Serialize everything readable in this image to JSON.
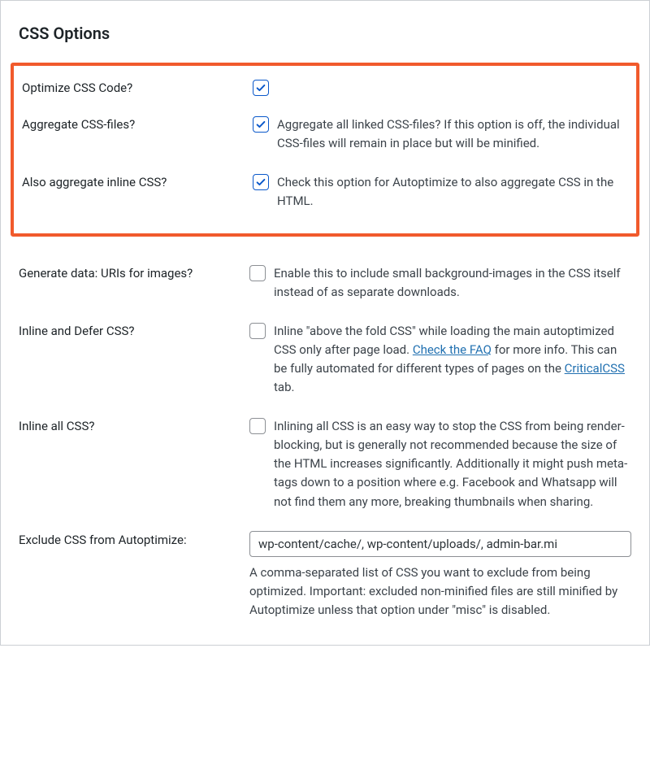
{
  "panelTitle": "CSS Options",
  "optimize": {
    "label": "Optimize CSS Code?",
    "checked": true,
    "desc": ""
  },
  "aggregate": {
    "label": "Aggregate CSS-files?",
    "checked": true,
    "desc": "Aggregate all linked CSS-files? If this option is off, the individual CSS-files will remain in place but will be minified."
  },
  "aggregateInline": {
    "label": "Also aggregate inline CSS?",
    "checked": true,
    "desc": "Check this option for Autoptimize to also aggregate CSS in the HTML."
  },
  "dataUris": {
    "label": "Generate data: URIs for images?",
    "checked": false,
    "desc": "Enable this to include small background-images in the CSS itself instead of as separate downloads."
  },
  "inlineDefer": {
    "label": "Inline and Defer CSS?",
    "checked": false,
    "desc_pre": "Inline \"above the fold CSS\" while loading the main autoptimized CSS only after page load. ",
    "faqLinkText": "Check the FAQ",
    "desc_mid": " for more info. This can be fully automated for different types of pages on the ",
    "criticalLinkText": "CriticalCSS",
    "desc_post": " tab."
  },
  "inlineAll": {
    "label": "Inline all CSS?",
    "checked": false,
    "desc": "Inlining all CSS is an easy way to stop the CSS from being render-blocking, but is generally not recommended because the size of the HTML increases significantly. Additionally it might push meta-tags down to a position where e.g. Facebook and Whatsapp will not find them any more, breaking thumbnails when sharing."
  },
  "exclude": {
    "label": "Exclude CSS from Autoptimize:",
    "value": "wp-content/cache/, wp-content/uploads/, admin-bar.mi",
    "desc": "A comma-separated list of CSS you want to exclude from being optimized. Important: excluded non-minified files are still minified by Autoptimize unless that option under \"misc\" is disabled."
  }
}
